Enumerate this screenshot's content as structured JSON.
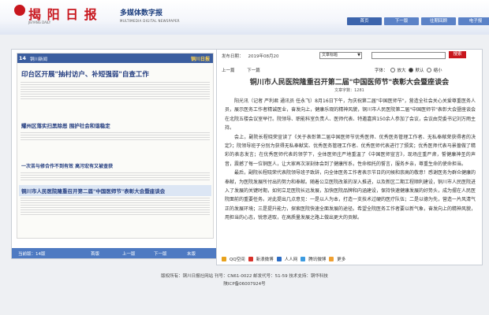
{
  "header": {
    "logo_text": "揭 阳 日 报",
    "logo_sub": "JIEYANG DAILY",
    "title_cn": "多媒体数字报",
    "title_en": "MULTIMEDIA DIGITAL NEWSPAPER",
    "nav": [
      "首页",
      "下一版",
      "往期回顾",
      "电子报"
    ]
  },
  "paper": {
    "page_no": "14",
    "section": "铜川新闻",
    "brand": "铜川日报",
    "headlines": [
      "印台区开展\"抽村访户、补短强弱\"自查工作",
      "耀州区落实扫黑除恶 围护社会和谐稳定",
      "一次苦与修合作不到有效 高污宏有又被查获",
      "铜川市人民医院隆重召开第二届\"中国医师节\"表彰大会暨座谈会"
    ]
  },
  "pager": {
    "current": "当前版：14版",
    "first": "首版",
    "prev": "上一版",
    "next": "下一版",
    "last": "末版"
  },
  "article_meta": {
    "date_label": "发布日期：",
    "date": "2019年08月20",
    "select_label": "文章标题",
    "search_button": "搜索",
    "prev": "上一篇",
    "next": "下一篇",
    "fontsize_label": "字体：",
    "font_options": [
      "放大",
      "默认",
      "缩小"
    ]
  },
  "article": {
    "title": "铜川市人民医院隆重召开第二届\"中国医师节\"表彰大会暨座谈会",
    "word_count": "文章字数：1281",
    "paragraphs": [
      "阳光讯（记者 严利君 通讯员 任永飞）8月16日下午，为庆祝第二届\"中国医师节\"，营造全社会关心关爱尊重医务人员，展示医务工作者精诚医业，奋发向上，健康乐观的精神风貌，铜川市人民医院第二届\"中国医师节\"表彰大会暨座谈会在北院五楼会议室举行。院领导、职能科室负责人、医师代表、特邀嘉宾150余人参加了会议，会议由党委书记刘万雨主持。",
      "会上，副院长程晓荣宣读了《关于表彰第二届中国医师节优秀医师、优秀医务管理工作者、无私奉献荣获得者的决定》；院领导班子分别为获得无私奉献奖、优秀医务管理工作者、优秀医师代表进行了颁奖；优秀医师代表马景蔷做了精彩的表态发言；在优秀医师代表的领学下，全体医师庄严地重温了《中国医师宣言》，现场庄重严肃，誓健康神圣的声音，震撼了每一位铜医人，让大家再次深刻体会到了健康所系，性命相托的誓言，服务乡亲，尊重生命的使命担当。",
      "最后，副院长程晓荣代表院领导班子致辞，向全体医务工作者表示节日的问候和崇高的敬意！感谢医务为群众健康的奉献，为医院发展所付出的努力和奉献。随着公立医院改革的深入推进，以及新区二期工程顺利建设，铜川市人民医院进入了发展的关键时期，如何立足医院长远发展，加快医院品牌和内涵建设，保持快速健康发展的好势头，成为摆在人民医院面前的重要任务。对此提出几点意见：一是以人为本，打造一支技术过硬的医疗队伍；二是以德为先，营造一片风清气正的发展环境；三是提升能力，探索医院快速全面发展的途径。希望全院医务工作者要以新气象，奋发向上的精神风貌，用担当的心态，锐意进取，在高质量发展之路上做出更大的贡献。"
    ]
  },
  "share": {
    "items": [
      "QQ空间",
      "新浪微博",
      "人人网",
      "腾讯微博",
      "更多"
    ],
    "colors": [
      "#e8a21c",
      "#d8322a",
      "#2b6cc4",
      "#3c9be0",
      "#f0a030"
    ]
  },
  "footer": {
    "line1": "版权所有：铜川日报社网站 刊号：CN61-0022 邮发代号：51-59 技术支持：铜华科技",
    "line2": "陕ICP备06007924号"
  }
}
